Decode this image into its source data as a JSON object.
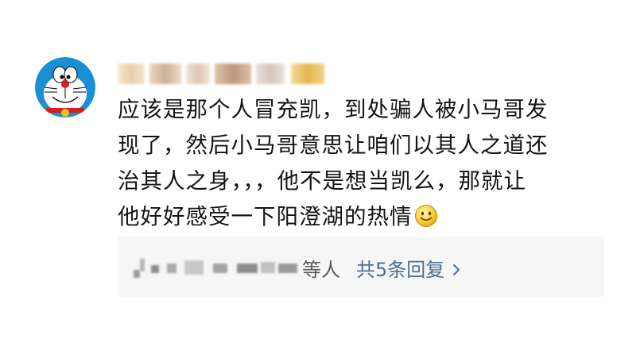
{
  "comment": {
    "avatar_icon": "doraemon-avatar-icon",
    "username_blurred": true,
    "lines": [
      "应该是那个人冒充凯，到处骗人被小马哥发",
      "现了，然后小马哥意思让咱们以其人之道还",
      "治其人之身，，，他不是想当凯么，那就让",
      "他好好感受一下阳澄湖的热情"
    ],
    "emoji_icon": "smiley-emoji-icon"
  },
  "replies": {
    "suffix": "等人",
    "count_label": "共5条回复",
    "chevron_icon": "chevron-right-icon",
    "colors": {
      "link": "#4a6f95",
      "box_bg": "#f6f6f6"
    }
  }
}
